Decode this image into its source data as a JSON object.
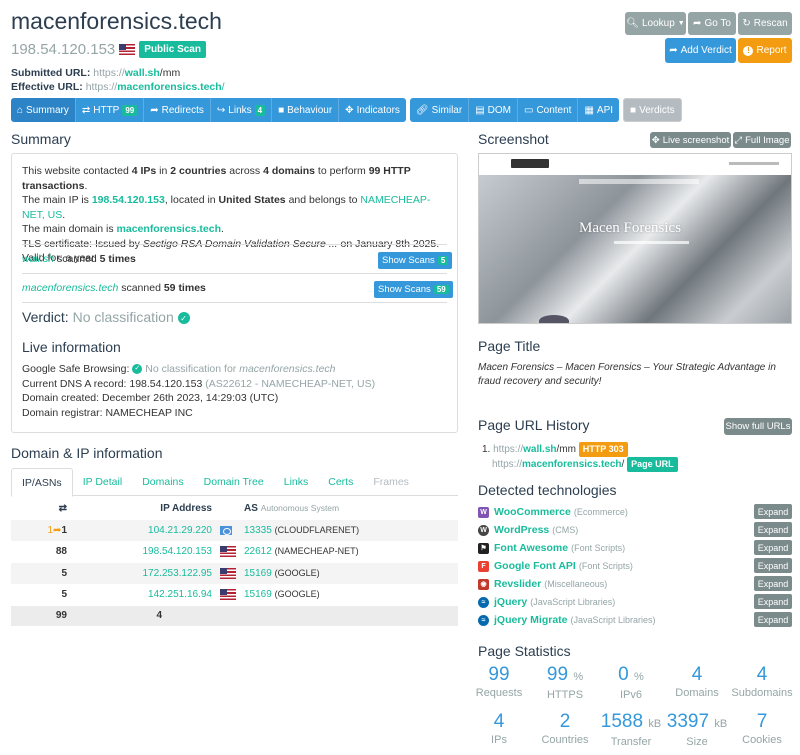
{
  "header": {
    "title": "macenforensics.tech",
    "ip": "198.54.120.153",
    "public_scan": "Public Scan",
    "submitted_label": "Submitted URL:",
    "submitted_proto": "https://",
    "submitted_host": "wall.sh",
    "submitted_path": "/mm",
    "effective_label": "Effective URL:",
    "effective_proto": "https://",
    "effective_host": "macenforensics.tech",
    "effective_path": "/"
  },
  "actions": {
    "lookup": "Lookup",
    "goto": "Go To",
    "rescan": "Rescan",
    "add_verdict": "Add Verdict",
    "report": "Report"
  },
  "tabs": [
    {
      "label": "Summary"
    },
    {
      "label": "HTTP",
      "count": "99"
    },
    {
      "label": "Redirects"
    },
    {
      "label": "Links",
      "count": "4"
    },
    {
      "label": "Behaviour"
    },
    {
      "label": "Indicators"
    },
    {
      "label": "Similar"
    },
    {
      "label": "DOM"
    },
    {
      "label": "Content"
    },
    {
      "label": "API"
    },
    {
      "label": "Verdicts"
    }
  ],
  "summary": {
    "heading": "Summary",
    "s1a": "This website contacted ",
    "s1_ips": "4 IPs",
    "s1b": " in ",
    "s1_countries": "2 countries",
    "s1c": " across ",
    "s1_domains": "4 domains",
    "s1d": " to perform ",
    "s1_tx": "99 HTTP transactions",
    "s1e": ".",
    "s2a": "The main IP is ",
    "s2_ip": "198.54.120.153",
    "s2b": ", located in ",
    "s2_country": "United States",
    "s2c": " and belongs to ",
    "s2_asn": "NAMECHEAP-NET, US",
    "s2d": ".",
    "s3a": "The main domain is ",
    "s3_domain": "macenforensics.tech",
    "s3b": ".",
    "s4a": "TLS certificate: Issued by ",
    "s4_issuer": "Sectigo RSA Domain Validation Secure ...",
    "s4b": " on January 8th 2025. Valid for: a year.",
    "scan1_domain": "wall.sh",
    "scan1_text": " scanned ",
    "scan1_times": "5 times",
    "scan1_btn": "Show Scans",
    "scan1_count": "5",
    "scan2_domain": "macenforensics.tech",
    "scan2_text": " scanned ",
    "scan2_times": "59 times",
    "scan2_btn": "Show Scans",
    "scan2_count": "59",
    "verdict_label": "Verdict:",
    "verdict_value": "No classification",
    "live_heading": "Live information",
    "gsb_label": "Google Safe Browsing:",
    "gsb_value": "No classification for ",
    "gsb_domain": "macenforensics.tech",
    "dns_label": "Current DNS A record: 198.54.120.153",
    "dns_asn": "(AS22612 - NAMECHEAP-NET, US)",
    "created": "Domain created: December 26th 2023, 14:29:03 (UTC)",
    "registrar": "Domain registrar: NAMECHEAP INC"
  },
  "domain_ip": {
    "heading": "Domain & IP information",
    "subtabs": [
      "IP/ASNs",
      "IP Detail",
      "Domains",
      "Domain Tree",
      "Links",
      "Certs",
      "Frames"
    ],
    "col_ip": "IP Address",
    "col_as": "AS",
    "col_as_sub": "Autonomous System",
    "rows": [
      {
        "redir": "1",
        "count": "1",
        "ip": "104.21.29.220",
        "flag": "un",
        "asn": "13335",
        "desc": "(CLOUDFLARENET)"
      },
      {
        "redir": "",
        "count": "88",
        "ip": "198.54.120.153",
        "flag": "us",
        "asn": "22612",
        "desc": "(NAMECHEAP-NET)"
      },
      {
        "redir": "",
        "count": "5",
        "ip": "172.253.122.95",
        "flag": "us",
        "asn": "15169",
        "desc": "(GOOGLE)"
      },
      {
        "redir": "",
        "count": "5",
        "ip": "142.251.16.94",
        "flag": "us",
        "asn": "15169",
        "desc": "(GOOGLE)"
      }
    ],
    "total_count": "99",
    "total_ips": "4"
  },
  "screenshot": {
    "heading": "Screenshot",
    "live_btn": "Live screenshot",
    "full_btn": "Full Image",
    "site_title": "Macen Forensics"
  },
  "page_title": {
    "heading": "Page Title",
    "value": "Macen Forensics – Macen Forensics – Your Strategic Advantage in fraud recovery and security!"
  },
  "url_history": {
    "heading": "Page URL History",
    "show_btn": "Show full URLs",
    "item1_num": "1.",
    "item1_proto": "https://",
    "item1_host": "wall.sh",
    "item1_path": "/mm",
    "item1_badge": "HTTP 303",
    "item2_proto": "https://",
    "item2_host": "macenforensics.tech",
    "item2_path": "/",
    "item2_badge": "Page URL"
  },
  "technologies": {
    "heading": "Detected technologies",
    "expand_label": "Expand",
    "items": [
      {
        "name": "WooCommerce",
        "category": "(Ecommerce)",
        "icon": "woocommerce-icon",
        "color": "#7f54b3"
      },
      {
        "name": "WordPress",
        "category": "(CMS)",
        "icon": "wordpress-icon",
        "color": "#464646"
      },
      {
        "name": "Font Awesome",
        "category": "(Font Scripts)",
        "icon": "flag-icon",
        "color": "#222222"
      },
      {
        "name": "Google Font API",
        "category": "(Font Scripts)",
        "icon": "google-font-icon",
        "color": "#e94235"
      },
      {
        "name": "Revslider",
        "category": "(Miscellaneous)",
        "icon": "revslider-icon",
        "color": "#c0392b"
      },
      {
        "name": "jQuery",
        "category": "(JavaScript Libraries)",
        "icon": "jquery-icon",
        "color": "#0769ad"
      },
      {
        "name": "jQuery Migrate",
        "category": "(JavaScript Libraries)",
        "icon": "jquery-icon",
        "color": "#0769ad"
      }
    ]
  },
  "stats": {
    "heading": "Page Statistics",
    "items": [
      {
        "value": "99",
        "unit": "",
        "label": "Requests"
      },
      {
        "value": "99",
        "unit": "%",
        "label": "HTTPS"
      },
      {
        "value": "0",
        "unit": "%",
        "label": "IPv6"
      },
      {
        "value": "4",
        "unit": "",
        "label": "Domains"
      },
      {
        "value": "4",
        "unit": "",
        "label": "Subdomains"
      },
      {
        "value": "4",
        "unit": "",
        "label": "IPs"
      },
      {
        "value": "2",
        "unit": "",
        "label": "Countries"
      },
      {
        "value": "1588",
        "unit": "kB",
        "label": "Transfer"
      },
      {
        "value": "3397",
        "unit": "kB",
        "label": "Size"
      },
      {
        "value": "7",
        "unit": "",
        "label": "Cookies"
      }
    ]
  },
  "colors": {
    "teal": "#18bc9c",
    "blue": "#3498db",
    "grey": "#95a5a6",
    "orange": "#f39c12",
    "navy": "#2c3e50"
  }
}
